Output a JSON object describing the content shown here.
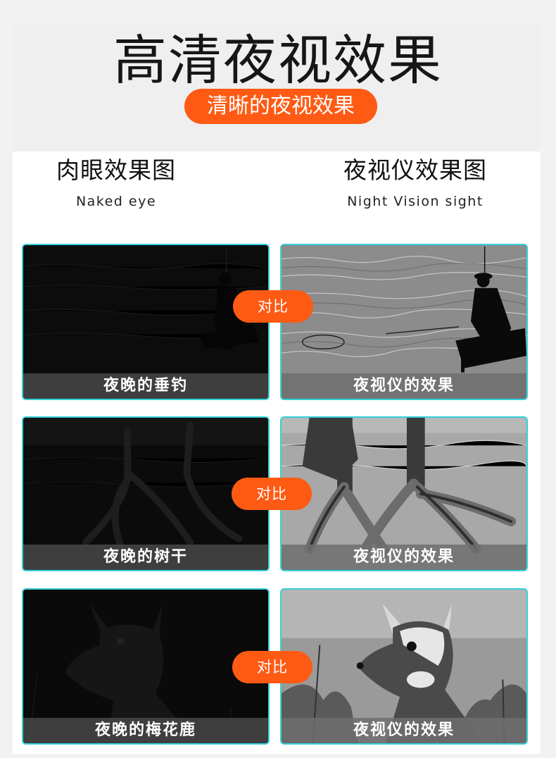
{
  "header": {
    "title": "高清夜视效果",
    "subtitle": "清晰的夜视效果"
  },
  "columns": {
    "left": {
      "title_zh": "肉眼效果图",
      "title_en": "Naked eye"
    },
    "right": {
      "title_zh": "夜视仪效果图",
      "title_en": "Night Vision sight"
    }
  },
  "rows": [
    {
      "left_caption": "夜晚的垂钓",
      "right_caption": "夜视仪的效果",
      "compare": "对比"
    },
    {
      "left_caption": "夜晚的树干",
      "right_caption": "夜视仪的效果",
      "compare": "对比"
    },
    {
      "left_caption": "夜晚的梅花鹿",
      "right_caption": "夜视仪的效果",
      "compare": "对比"
    }
  ],
  "colors": {
    "accent": "#fe5a14",
    "frame": "#35d0d8"
  }
}
